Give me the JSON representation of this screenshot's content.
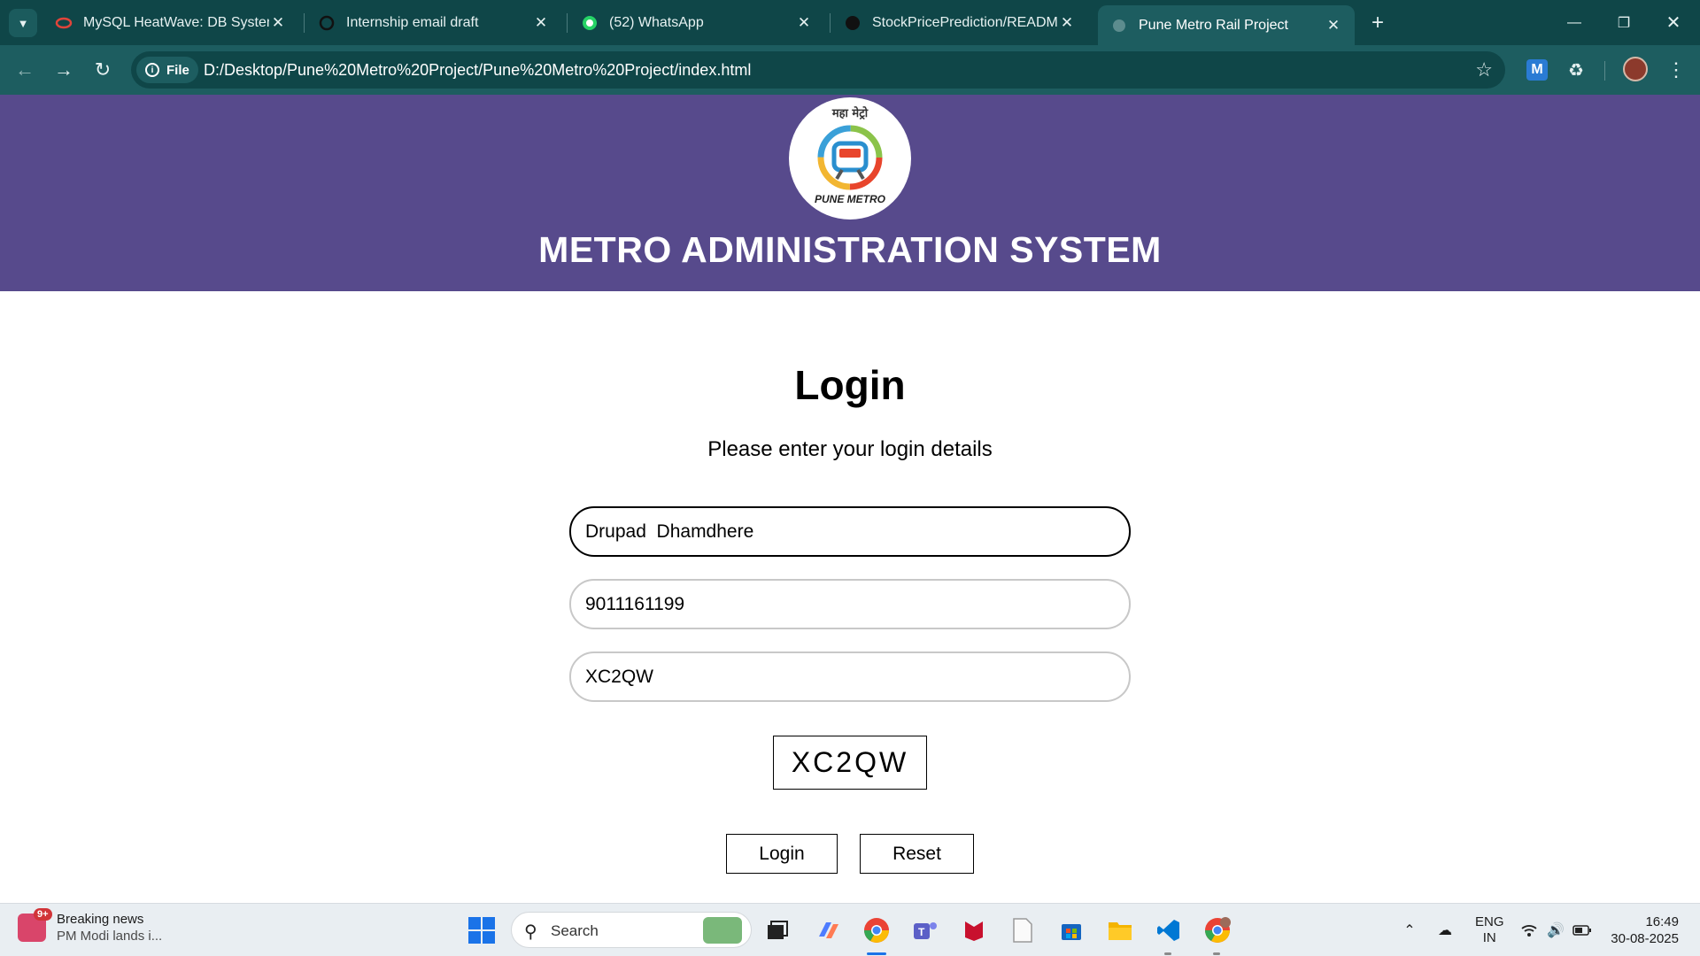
{
  "browser": {
    "tabs": [
      {
        "title": "MySQL HeatWave: DB System E",
        "icon": "oracle-icon",
        "active": false
      },
      {
        "title": "Internship email draft",
        "icon": "chatgpt-icon",
        "active": false
      },
      {
        "title": "(52) WhatsApp",
        "icon": "whatsapp-icon",
        "active": false
      },
      {
        "title": "StockPricePrediction/README.m",
        "icon": "github-icon",
        "active": false
      },
      {
        "title": "Pune Metro Rail Project",
        "icon": "globe-icon",
        "active": true
      }
    ],
    "site_chip": "File",
    "url": "D:/Desktop/Pune%20Metro%20Project/Pune%20Metro%20Project/index.html"
  },
  "header": {
    "logo_top_text": "महा मेट्रो",
    "logo_bottom_text": "PUNE METRO",
    "title": "METRO ADMINISTRATION SYSTEM"
  },
  "login": {
    "title": "Login",
    "subtitle": "Please enter your login details",
    "name_value": "Drupad  Dhamdhere",
    "phone_value": "9011161199",
    "captcha_input_value": "XC2QW",
    "captcha_text": "XC2QW",
    "login_label": "Login",
    "reset_label": "Reset"
  },
  "taskbar": {
    "news_badge": "9+",
    "news_title": "Breaking news",
    "news_sub": "PM Modi lands i...",
    "search_label": "Search",
    "lang_top": "ENG",
    "lang_bottom": "IN",
    "time": "16:49",
    "date": "30-08-2025"
  },
  "colors": {
    "header_bg": "#574a8c",
    "browser_frame": "#0f4648",
    "browser_toolbar": "#1d5d60"
  }
}
